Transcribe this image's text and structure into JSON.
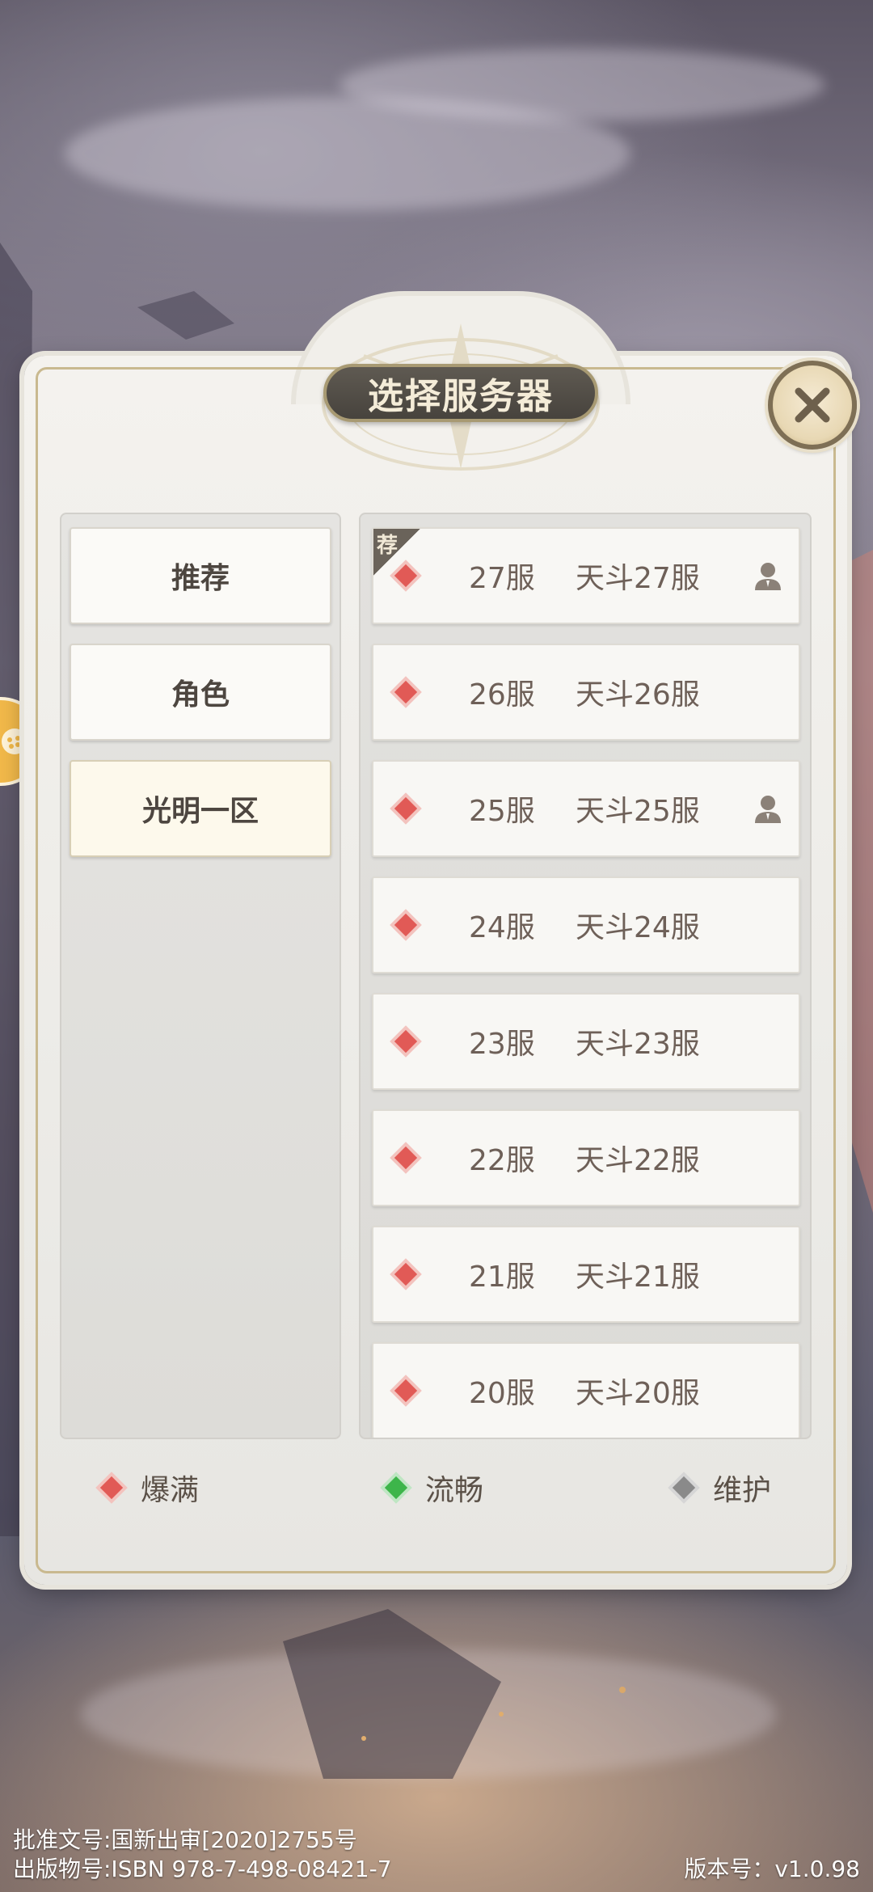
{
  "dialog": {
    "title": "选择服务器",
    "close_label": "close"
  },
  "tabs": [
    {
      "label": "推荐",
      "active": false
    },
    {
      "label": "角色",
      "active": false
    },
    {
      "label": "光明一区",
      "active": true
    }
  ],
  "servers": [
    {
      "number": "27服",
      "name": "天斗27服",
      "status": "爆满",
      "has_character": true,
      "recommended": true,
      "badge": "荐"
    },
    {
      "number": "26服",
      "name": "天斗26服",
      "status": "爆满",
      "has_character": false
    },
    {
      "number": "25服",
      "name": "天斗25服",
      "status": "爆满",
      "has_character": true
    },
    {
      "number": "24服",
      "name": "天斗24服",
      "status": "爆满",
      "has_character": false
    },
    {
      "number": "23服",
      "name": "天斗23服",
      "status": "爆满",
      "has_character": false
    },
    {
      "number": "22服",
      "name": "天斗22服",
      "status": "爆满",
      "has_character": false
    },
    {
      "number": "21服",
      "name": "天斗21服",
      "status": "爆满",
      "has_character": false
    },
    {
      "number": "20服",
      "name": "天斗20服",
      "status": "爆满",
      "has_character": false
    }
  ],
  "legend": [
    {
      "label": "爆满",
      "color": "#e15a56"
    },
    {
      "label": "流畅",
      "color": "#3db54a"
    },
    {
      "label": "维护",
      "color": "#8a8a8a"
    }
  ],
  "footer": {
    "approval": "批准文号:国新出审[2020]2755号",
    "isbn": "出版物号:ISBN 978-7-498-08421-7",
    "version": "版本号：v1.0.98"
  },
  "colors": {
    "full": "#e15a56",
    "smooth": "#3db54a",
    "maintenance": "#8a8a8a",
    "accent_gold": "#c9b98f"
  }
}
